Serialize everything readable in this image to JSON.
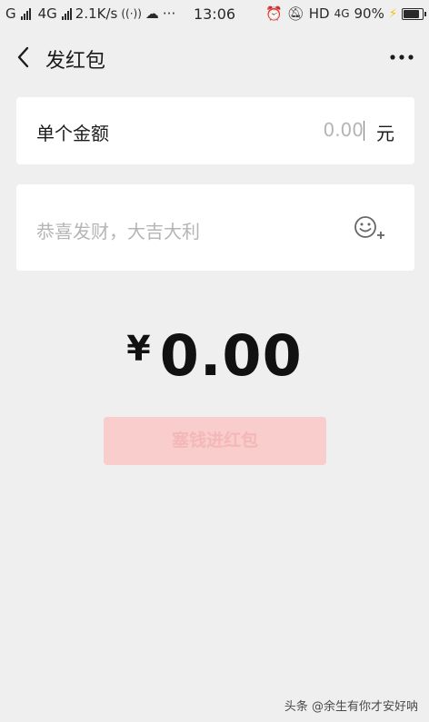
{
  "status_bar": {
    "carrier1": "G",
    "carrier2": "4G",
    "net_speed": "2.1K/s",
    "extra_icons": "···",
    "time": "13:06",
    "hd": "HD",
    "net_type": "4G",
    "battery_percent": "90%"
  },
  "nav": {
    "title": "发红包"
  },
  "amount": {
    "label": "单个金额",
    "placeholder": "0.00",
    "unit": "元"
  },
  "message": {
    "placeholder": "恭喜发财，大吉大利"
  },
  "total": {
    "symbol": "¥",
    "value": "0.00"
  },
  "submit": {
    "label": "塞钱进红包",
    "enabled": false
  },
  "watermark": {
    "text": "头条 @余生有你才安好呐"
  },
  "colors": {
    "background": "#efeff0",
    "card": "#ffffff",
    "submit_disabled": "#f8cdcc"
  }
}
